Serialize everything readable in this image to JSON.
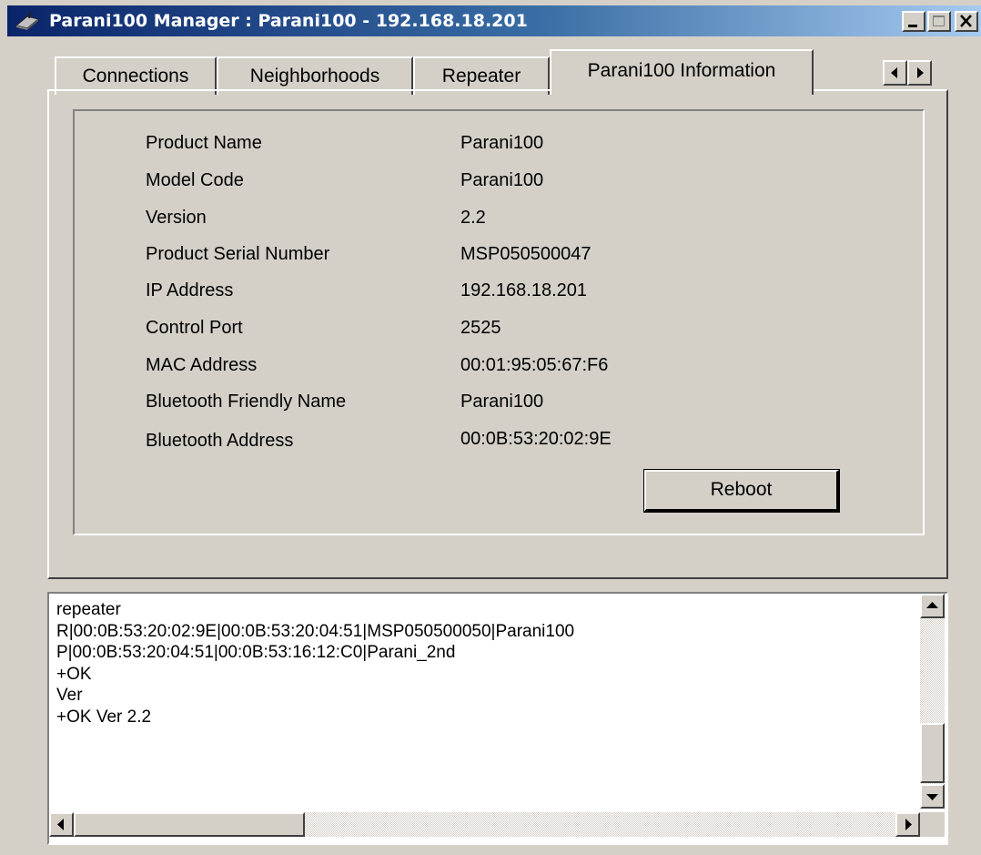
{
  "window": {
    "title": "Parani100 Manager : Parani100 - 192.168.18.201",
    "icon": "bluetooth-device-icon"
  },
  "tabs": [
    {
      "label": "Connections",
      "active": false
    },
    {
      "label": "Neighborhoods",
      "active": false
    },
    {
      "label": "Repeater",
      "active": false
    },
    {
      "label": "Parani100 Information",
      "active": true
    }
  ],
  "info": {
    "rows": [
      {
        "label": "Product Name",
        "value": "Parani100"
      },
      {
        "label": "Model Code",
        "value": "Parani100"
      },
      {
        "label": "Version",
        "value": "2.2"
      },
      {
        "label": "Product Serial Number",
        "value": "MSP050500047"
      },
      {
        "label": "IP Address",
        "value": "192.168.18.201"
      },
      {
        "label": "Control Port",
        "value": "2525"
      },
      {
        "label": "MAC Address",
        "value": "00:01:95:05:67:F6"
      },
      {
        "label": "Bluetooth Friendly Name",
        "value": "Parani100"
      },
      {
        "label": "Bluetooth Address",
        "value": "00:0B:53:20:02:9E"
      }
    ],
    "reboot_label": "Reboot"
  },
  "log": {
    "lines": [
      "repeater",
      "R|00:0B:53:20:02:9E|00:0B:53:20:04:51|MSP050500050|Parani100",
      "P|00:0B:53:20:04:51|00:0B:53:16:12:C0|Parani_2nd",
      "+OK",
      "Ver",
      "+OK Ver 2.2"
    ]
  },
  "colors": {
    "titlebar_start": "#0a246a",
    "titlebar_end": "#a6caf0",
    "face": "#d4d0c8"
  }
}
